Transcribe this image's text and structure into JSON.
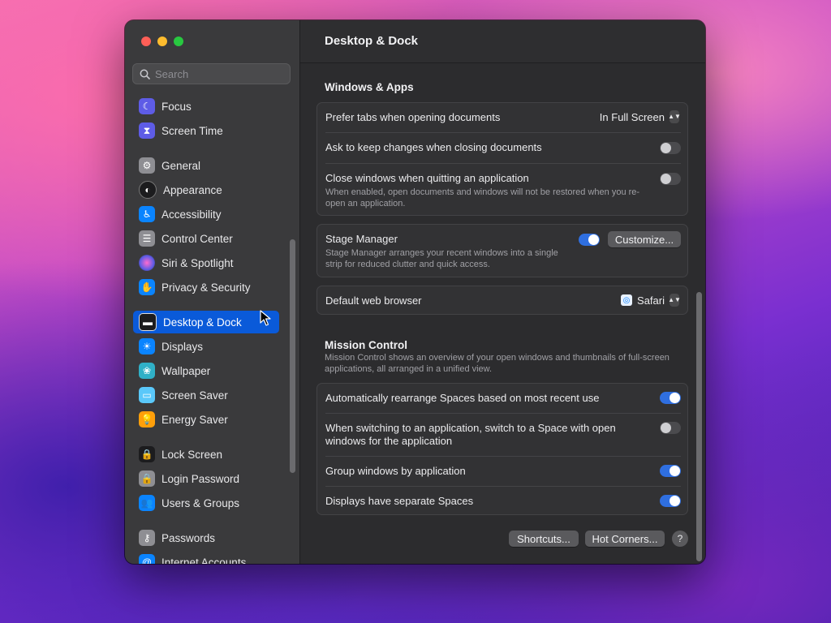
{
  "window": {
    "title": "Desktop & Dock"
  },
  "search": {
    "placeholder": "Search"
  },
  "sidebar": {
    "items": [
      {
        "label": "Focus",
        "icon": "moon-icon",
        "color": "#5e5ce6"
      },
      {
        "label": "Screen Time",
        "icon": "hourglass-icon",
        "color": "#5e5ce6"
      },
      {
        "label": "General",
        "icon": "gear-icon",
        "color": "#8e8e93"
      },
      {
        "label": "Appearance",
        "icon": "appearance-icon",
        "color": "#1c1c1e"
      },
      {
        "label": "Accessibility",
        "icon": "accessibility-icon",
        "color": "#0a84ff"
      },
      {
        "label": "Control Center",
        "icon": "control-center-icon",
        "color": "#8e8e93"
      },
      {
        "label": "Siri & Spotlight",
        "icon": "siri-icon",
        "color": "#bf5af2"
      },
      {
        "label": "Privacy & Security",
        "icon": "hand-icon",
        "color": "#0a84ff"
      },
      {
        "label": "Desktop & Dock",
        "icon": "dock-icon",
        "color": "#1c1c1e"
      },
      {
        "label": "Displays",
        "icon": "sun-icon",
        "color": "#0a84ff"
      },
      {
        "label": "Wallpaper",
        "icon": "flower-icon",
        "color": "#30b0c7"
      },
      {
        "label": "Screen Saver",
        "icon": "screensaver-icon",
        "color": "#5ac8fa"
      },
      {
        "label": "Energy Saver",
        "icon": "bulb-icon",
        "color": "#ff9f0a"
      },
      {
        "label": "Lock Screen",
        "icon": "lock-icon",
        "color": "#1c1c1e"
      },
      {
        "label": "Login Password",
        "icon": "lock-icon",
        "color": "#8e8e93"
      },
      {
        "label": "Users & Groups",
        "icon": "users-icon",
        "color": "#0a84ff"
      },
      {
        "label": "Passwords",
        "icon": "key-icon",
        "color": "#8e8e93"
      },
      {
        "label": "Internet Accounts",
        "icon": "at-icon",
        "color": "#0a84ff"
      }
    ]
  },
  "windows_apps": {
    "heading": "Windows & Apps",
    "prefer_tabs": {
      "label": "Prefer tabs when opening documents",
      "value": "In Full Screen"
    },
    "ask_keep": {
      "label": "Ask to keep changes when closing documents",
      "on": false
    },
    "close_windows": {
      "label": "Close windows when quitting an application",
      "desc": "When enabled, open documents and windows will not be restored when you re-open an application.",
      "on": false
    }
  },
  "stage_manager": {
    "label": "Stage Manager",
    "desc": "Stage Manager arranges your recent windows into a single strip for reduced clutter and quick access.",
    "on": true,
    "customize": "Customize..."
  },
  "browser": {
    "label": "Default web browser",
    "value": "Safari"
  },
  "mission_control": {
    "heading": "Mission Control",
    "desc": "Mission Control shows an overview of your open windows and thumbnails of full-screen applications, all arranged in a unified view.",
    "rows": [
      {
        "label": "Automatically rearrange Spaces based on most recent use",
        "on": true
      },
      {
        "label": "When switching to an application, switch to a Space with open windows for the application",
        "on": false
      },
      {
        "label": "Group windows by application",
        "on": true
      },
      {
        "label": "Displays have separate Spaces",
        "on": true
      }
    ]
  },
  "footer": {
    "shortcuts": "Shortcuts...",
    "hot_corners": "Hot Corners...",
    "help": "?"
  }
}
